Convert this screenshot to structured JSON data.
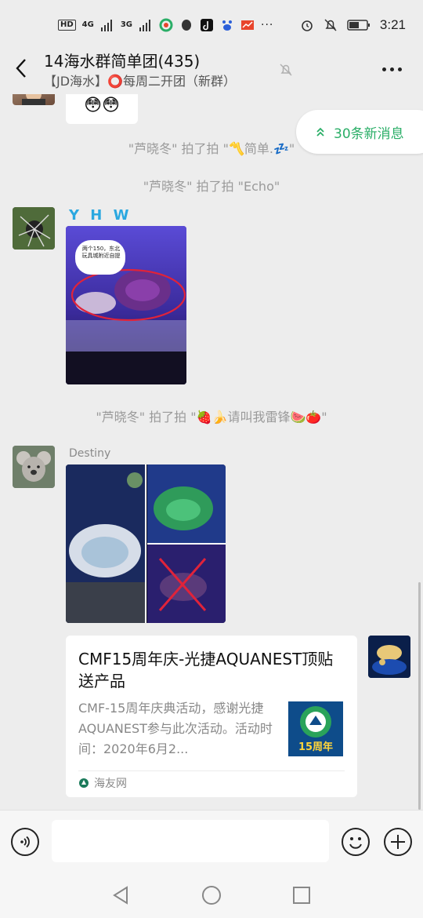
{
  "status_bar": {
    "hd_label": "HD",
    "network_1": "4G",
    "network_2": "3G",
    "time": "3:21"
  },
  "header": {
    "title": "14海水群简单团(435)",
    "subtitle": "【JD海水】⭕每周二开团（新群）"
  },
  "chat": {
    "new_messages_label": "30条新消息",
    "messages": [
      {
        "type": "emoji",
        "content": "😳😳"
      },
      {
        "type": "system",
        "text": "\"芦晓冬\" 拍了拍 \"〽️简单.💤\""
      },
      {
        "type": "system",
        "text": "\"芦晓冬\" 拍了拍 \"Echo\""
      },
      {
        "type": "image",
        "sender": "Y H W",
        "image_caption": "两个150，东北玩具城附近自提"
      },
      {
        "type": "system",
        "text": "\"芦晓冬\" 拍了拍 \"🍓🍌请叫我雷锋🍉🍅\""
      },
      {
        "type": "image",
        "sender": "Destiny"
      }
    ],
    "link_card": {
      "title": "CMF15周年庆-光捷AQUANEST顶贴送产品",
      "description": "CMF-15周年庆典活动，感谢光捷AQUANEST参与此次活动。活动时间：2020年6月2...",
      "thumb_label": "15周年",
      "source": "海友网"
    }
  },
  "colors": {
    "accent_green": "#2aae67",
    "background": "#ededed",
    "sender_yhw": "#2ba8e0"
  }
}
